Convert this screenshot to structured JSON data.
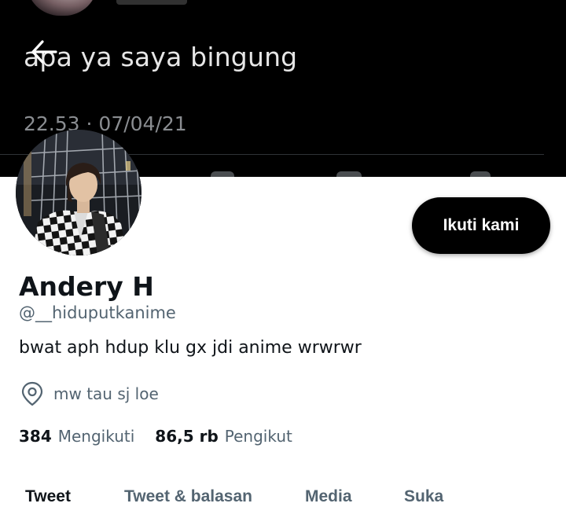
{
  "banner": {
    "tweet_text": "apa ya saya bingung",
    "timestamp": "22.53 · 07/04/21"
  },
  "header": {
    "back_icon": "arrow-left-icon"
  },
  "profile": {
    "display_name": "Andery H",
    "handle": "@__hiduputkanime",
    "bio": "bwat aph hdup klu gx jdi anime wrwrwr",
    "location": "mw tau sj loe",
    "follow_label": "Ikuti kami",
    "following_count": "384",
    "following_label": "Mengikuti",
    "followers_count": "86,5 rb",
    "followers_label": "Pengikut"
  },
  "tabs": [
    {
      "label": "Tweet"
    },
    {
      "label": "Tweet & balasan"
    },
    {
      "label": "Media"
    },
    {
      "label": "Suka"
    }
  ]
}
